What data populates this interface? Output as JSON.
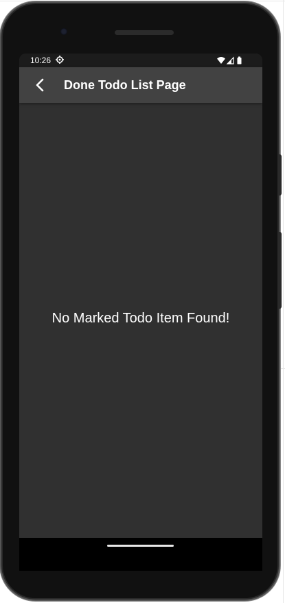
{
  "status_bar": {
    "time": "10:26",
    "icons": [
      "settings-icon",
      "wifi-icon",
      "signal-icon",
      "battery-icon"
    ]
  },
  "app_bar": {
    "title": "Done Todo List Page",
    "back_icon": "chevron-left-icon"
  },
  "main": {
    "empty_message": "No Marked Todo Item Found!"
  },
  "colors": {
    "screen_bg": "#303030",
    "app_bar_bg": "#424242",
    "status_bar_bg": "#1c1c1c",
    "text": "#ffffff",
    "phone_body": "#111111"
  }
}
